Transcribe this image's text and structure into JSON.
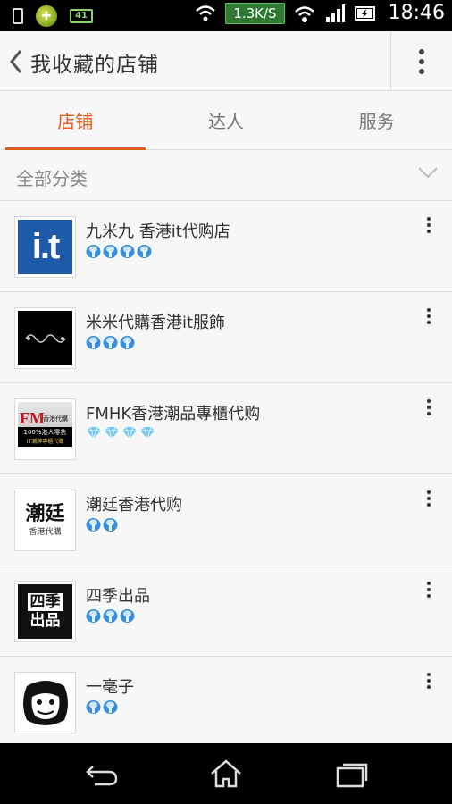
{
  "status_bar": {
    "network_speed": "1.3K/S",
    "time": "18:46",
    "battery_small_label": "41"
  },
  "header": {
    "title": "我收藏的店铺"
  },
  "tabs": [
    {
      "label": "店铺",
      "active": true
    },
    {
      "label": "达人",
      "active": false
    },
    {
      "label": "服务",
      "active": false
    }
  ],
  "filter": {
    "label": "全部分类"
  },
  "shops": [
    {
      "name": "九米九 香港it代购店",
      "rank_icon": "blue-crown",
      "rank_count": 4,
      "logo_text": "i.t"
    },
    {
      "name": "米米代購香港it服飾",
      "rank_icon": "blue-crown",
      "rank_count": 3,
      "logo_text": ""
    },
    {
      "name": "FMHK香港潮品專櫃代购",
      "rank_icon": "diamond",
      "rank_count": 4,
      "logo_text": "FM",
      "logo_sub1": "香港代購",
      "logo_sub2": "100%港人零售",
      "logo_sub3": "IT潮牌專櫃代購"
    },
    {
      "name": "潮廷香港代购",
      "rank_icon": "blue-crown",
      "rank_count": 2,
      "logo_text": "潮廷",
      "logo_sub1": "香港代購"
    },
    {
      "name": "四季出品",
      "rank_icon": "blue-crown",
      "rank_count": 3,
      "logo_text": "四季",
      "logo_sub1": "出品"
    },
    {
      "name": "一毫子",
      "rank_icon": "blue-crown",
      "rank_count": 2,
      "logo_text": ""
    }
  ],
  "colors": {
    "accent": "#e05a1a",
    "crown": "#3a8fd8",
    "diamond": "#6ec7f2"
  }
}
